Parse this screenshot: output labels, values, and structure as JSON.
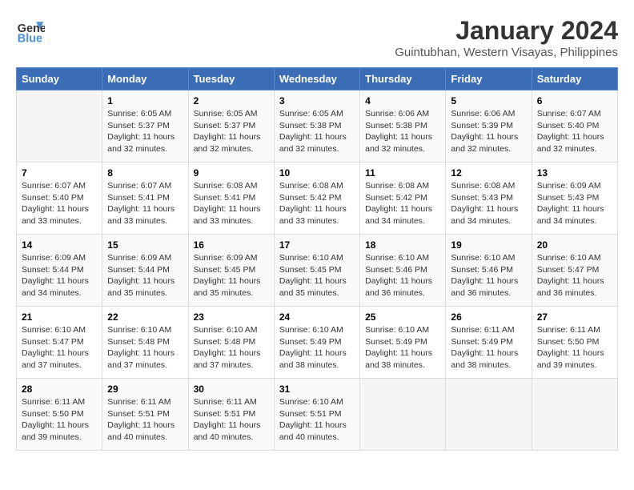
{
  "logo": {
    "line1": "General",
    "line2": "Blue"
  },
  "title": "January 2024",
  "subtitle": "Guintubhan, Western Visayas, Philippines",
  "days_header": [
    "Sunday",
    "Monday",
    "Tuesday",
    "Wednesday",
    "Thursday",
    "Friday",
    "Saturday"
  ],
  "weeks": [
    [
      {
        "day": "",
        "info": ""
      },
      {
        "day": "1",
        "info": "Sunrise: 6:05 AM\nSunset: 5:37 PM\nDaylight: 11 hours\nand 32 minutes."
      },
      {
        "day": "2",
        "info": "Sunrise: 6:05 AM\nSunset: 5:37 PM\nDaylight: 11 hours\nand 32 minutes."
      },
      {
        "day": "3",
        "info": "Sunrise: 6:05 AM\nSunset: 5:38 PM\nDaylight: 11 hours\nand 32 minutes."
      },
      {
        "day": "4",
        "info": "Sunrise: 6:06 AM\nSunset: 5:38 PM\nDaylight: 11 hours\nand 32 minutes."
      },
      {
        "day": "5",
        "info": "Sunrise: 6:06 AM\nSunset: 5:39 PM\nDaylight: 11 hours\nand 32 minutes."
      },
      {
        "day": "6",
        "info": "Sunrise: 6:07 AM\nSunset: 5:40 PM\nDaylight: 11 hours\nand 32 minutes."
      }
    ],
    [
      {
        "day": "7",
        "info": "Sunrise: 6:07 AM\nSunset: 5:40 PM\nDaylight: 11 hours\nand 33 minutes."
      },
      {
        "day": "8",
        "info": "Sunrise: 6:07 AM\nSunset: 5:41 PM\nDaylight: 11 hours\nand 33 minutes."
      },
      {
        "day": "9",
        "info": "Sunrise: 6:08 AM\nSunset: 5:41 PM\nDaylight: 11 hours\nand 33 minutes."
      },
      {
        "day": "10",
        "info": "Sunrise: 6:08 AM\nSunset: 5:42 PM\nDaylight: 11 hours\nand 33 minutes."
      },
      {
        "day": "11",
        "info": "Sunrise: 6:08 AM\nSunset: 5:42 PM\nDaylight: 11 hours\nand 34 minutes."
      },
      {
        "day": "12",
        "info": "Sunrise: 6:08 AM\nSunset: 5:43 PM\nDaylight: 11 hours\nand 34 minutes."
      },
      {
        "day": "13",
        "info": "Sunrise: 6:09 AM\nSunset: 5:43 PM\nDaylight: 11 hours\nand 34 minutes."
      }
    ],
    [
      {
        "day": "14",
        "info": "Sunrise: 6:09 AM\nSunset: 5:44 PM\nDaylight: 11 hours\nand 34 minutes."
      },
      {
        "day": "15",
        "info": "Sunrise: 6:09 AM\nSunset: 5:44 PM\nDaylight: 11 hours\nand 35 minutes."
      },
      {
        "day": "16",
        "info": "Sunrise: 6:09 AM\nSunset: 5:45 PM\nDaylight: 11 hours\nand 35 minutes."
      },
      {
        "day": "17",
        "info": "Sunrise: 6:10 AM\nSunset: 5:45 PM\nDaylight: 11 hours\nand 35 minutes."
      },
      {
        "day": "18",
        "info": "Sunrise: 6:10 AM\nSunset: 5:46 PM\nDaylight: 11 hours\nand 36 minutes."
      },
      {
        "day": "19",
        "info": "Sunrise: 6:10 AM\nSunset: 5:46 PM\nDaylight: 11 hours\nand 36 minutes."
      },
      {
        "day": "20",
        "info": "Sunrise: 6:10 AM\nSunset: 5:47 PM\nDaylight: 11 hours\nand 36 minutes."
      }
    ],
    [
      {
        "day": "21",
        "info": "Sunrise: 6:10 AM\nSunset: 5:47 PM\nDaylight: 11 hours\nand 37 minutes."
      },
      {
        "day": "22",
        "info": "Sunrise: 6:10 AM\nSunset: 5:48 PM\nDaylight: 11 hours\nand 37 minutes."
      },
      {
        "day": "23",
        "info": "Sunrise: 6:10 AM\nSunset: 5:48 PM\nDaylight: 11 hours\nand 37 minutes."
      },
      {
        "day": "24",
        "info": "Sunrise: 6:10 AM\nSunset: 5:49 PM\nDaylight: 11 hours\nand 38 minutes."
      },
      {
        "day": "25",
        "info": "Sunrise: 6:10 AM\nSunset: 5:49 PM\nDaylight: 11 hours\nand 38 minutes."
      },
      {
        "day": "26",
        "info": "Sunrise: 6:11 AM\nSunset: 5:49 PM\nDaylight: 11 hours\nand 38 minutes."
      },
      {
        "day": "27",
        "info": "Sunrise: 6:11 AM\nSunset: 5:50 PM\nDaylight: 11 hours\nand 39 minutes."
      }
    ],
    [
      {
        "day": "28",
        "info": "Sunrise: 6:11 AM\nSunset: 5:50 PM\nDaylight: 11 hours\nand 39 minutes."
      },
      {
        "day": "29",
        "info": "Sunrise: 6:11 AM\nSunset: 5:51 PM\nDaylight: 11 hours\nand 40 minutes."
      },
      {
        "day": "30",
        "info": "Sunrise: 6:11 AM\nSunset: 5:51 PM\nDaylight: 11 hours\nand 40 minutes."
      },
      {
        "day": "31",
        "info": "Sunrise: 6:10 AM\nSunset: 5:51 PM\nDaylight: 11 hours\nand 40 minutes."
      },
      {
        "day": "",
        "info": ""
      },
      {
        "day": "",
        "info": ""
      },
      {
        "day": "",
        "info": ""
      }
    ]
  ]
}
